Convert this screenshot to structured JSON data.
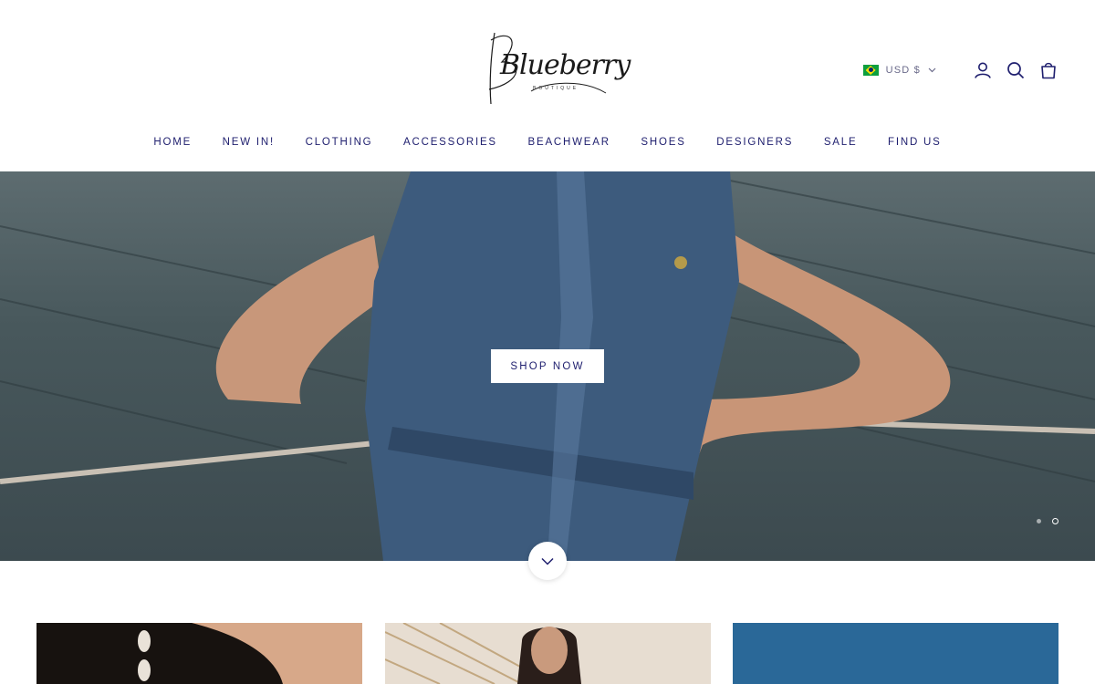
{
  "brand": {
    "logo_text": "Blueberry",
    "logo_subtext": "boutique"
  },
  "header": {
    "currency": {
      "flag": "brazil-flag-icon",
      "label": "USD $"
    },
    "icons": [
      "account-icon",
      "search-icon",
      "cart-icon"
    ]
  },
  "nav": {
    "items": [
      {
        "label": "HOME"
      },
      {
        "label": "NEW IN!"
      },
      {
        "label": "CLOTHING"
      },
      {
        "label": "ACCESSORIES"
      },
      {
        "label": "BEACHWEAR"
      },
      {
        "label": "SHOES"
      },
      {
        "label": "DESIGNERS"
      },
      {
        "label": "SALE"
      },
      {
        "label": "FIND US"
      }
    ]
  },
  "hero": {
    "cta_label": "SHOP NOW",
    "slides_count": 2,
    "active_slide": 2
  },
  "colors": {
    "nav_text": "#1e1e6e",
    "background": "#ffffff"
  }
}
